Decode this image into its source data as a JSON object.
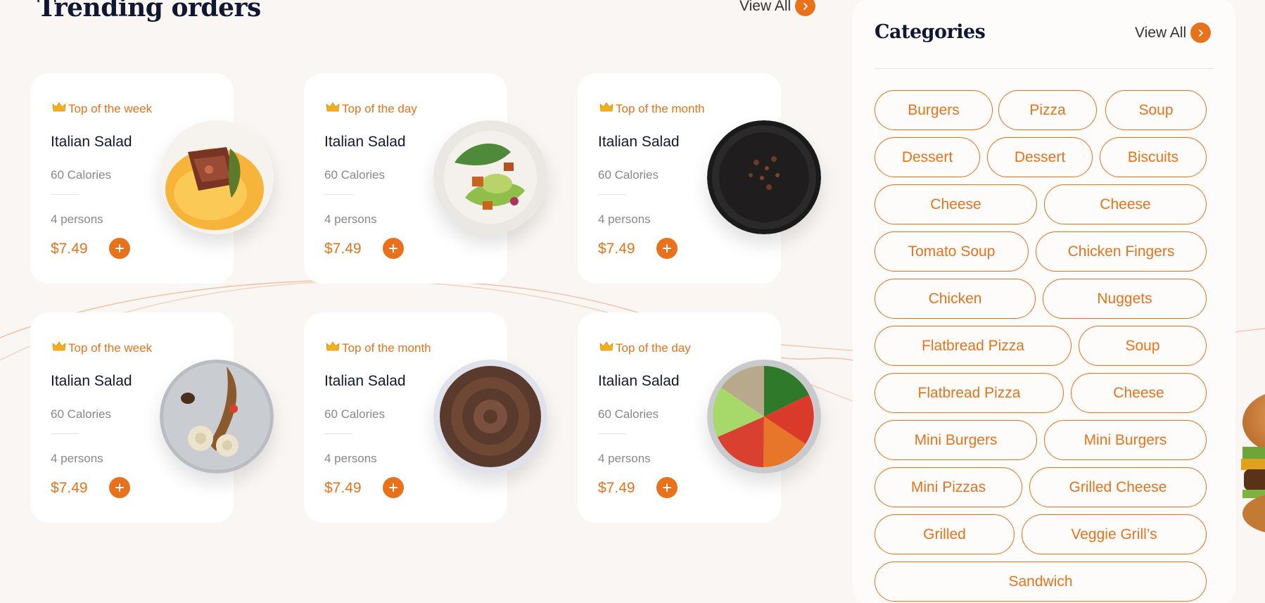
{
  "trending": {
    "title": "Trending orders",
    "view_all": "View All"
  },
  "cards": [
    {
      "badge": "Top of the week",
      "name": "Italian Salad",
      "calories": "60 Calories",
      "persons": "4 persons",
      "price": "$7.49",
      "image": "steak-with-sauce"
    },
    {
      "badge": "Top of the day",
      "name": "Italian Salad",
      "calories": "60 Calories",
      "persons": "4 persons",
      "price": "$7.49",
      "image": "green-salad"
    },
    {
      "badge": "Top of the month",
      "name": "Italian Salad",
      "calories": "60 Calories",
      "persons": "4 persons",
      "price": "$7.49",
      "image": "dark-soup-bowl"
    },
    {
      "badge": "Top of the week",
      "name": "Italian Salad",
      "calories": "60 Calories",
      "persons": "4 persons",
      "price": "$7.49",
      "image": "dumplings-plate"
    },
    {
      "badge": "Top of the month",
      "name": "Italian Salad",
      "calories": "60 Calories",
      "persons": "4 persons",
      "price": "$7.49",
      "image": "chocolate-cupcake"
    },
    {
      "badge": "Top of the day",
      "name": "Italian Salad",
      "calories": "60 Calories",
      "persons": "4 persons",
      "price": "$7.49",
      "image": "veggie-bowl"
    }
  ],
  "categories": {
    "title": "Categories",
    "view_all": "View All",
    "chips": [
      "Burgers",
      "Pizza",
      "Soup",
      "Dessert",
      "Dessert",
      "Biscuits",
      "Cheese",
      "Cheese",
      "Tomato Soup",
      "Chicken Fingers",
      "Chicken",
      "Nuggets",
      "Flatbread Pizza",
      "Soup",
      "Flatbread Pizza",
      "Cheese",
      "Mini Burgers",
      "Mini Burgers",
      "Mini Pizzas",
      "Grilled Cheese",
      "Grilled",
      "Veggie Grill’s",
      "Sandwich"
    ]
  },
  "colors": {
    "accent": "#e8721c",
    "heading": "#0f1733",
    "muted": "#888888",
    "background": "#f9f6f3"
  }
}
